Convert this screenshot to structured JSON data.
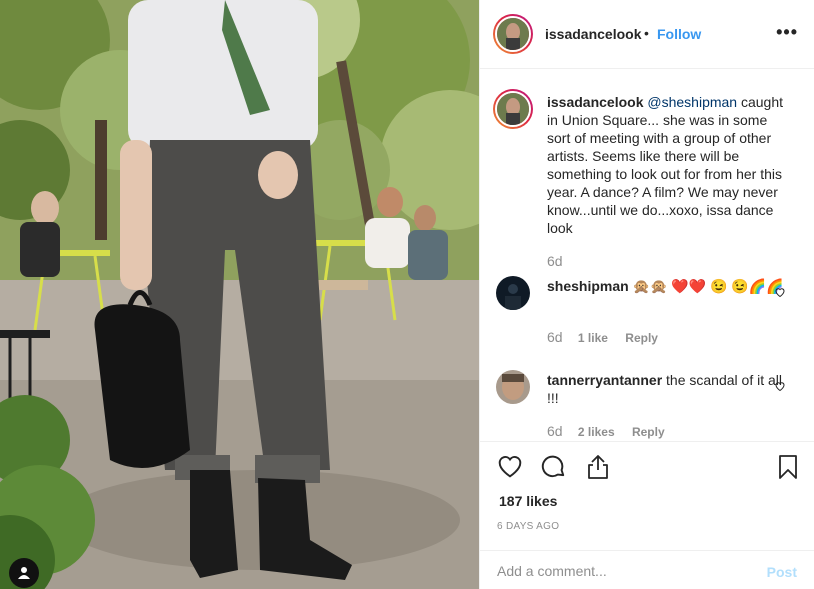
{
  "post": {
    "username": "issadancelook",
    "separator": "•",
    "follow_label": "Follow",
    "more_label": "•••"
  },
  "caption": {
    "username": "issadancelook",
    "mention": "@sheshipman",
    "text": " caught in Union Square... she was in some sort of meeting with a group of other artists. Seems like there will be something to look out for from her this year. A dance? A film? We may never know...until we do...xoxo, issa dance look",
    "age": "6d"
  },
  "comments": [
    {
      "username": "sheshipman",
      "text": " 🙊🙊 ❤️❤️ 😉 😉🌈🌈",
      "age": "6d",
      "likes": "1 like",
      "reply": "Reply"
    },
    {
      "username": "tannerryantanner",
      "text": " the scandal of it all !!!",
      "age": "6d",
      "likes": "2 likes",
      "reply": "Reply"
    }
  ],
  "engagement": {
    "likes": "187 likes",
    "posted": "6 DAYS AGO"
  },
  "composer": {
    "placeholder": "Add a comment...",
    "post_label": "Post"
  },
  "icons": {
    "like": "heart-icon",
    "comment": "comment-icon",
    "share": "share-icon",
    "save": "bookmark-icon",
    "tags": "user-tag-icon",
    "more": "more-icon"
  },
  "colors": {
    "link_blue": "#3897f0",
    "post_disabled": "#b2dffc",
    "muted": "#8e8e8e",
    "mention": "#003569"
  }
}
